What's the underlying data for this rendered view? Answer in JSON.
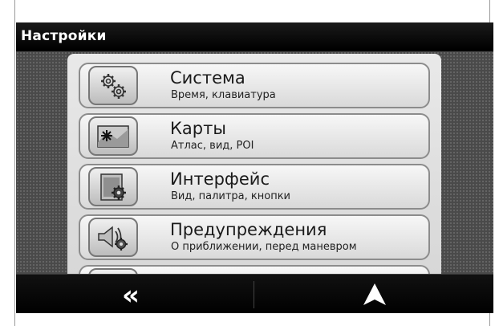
{
  "window": {
    "title": "Настройки"
  },
  "menu": {
    "items": [
      {
        "label": "Система",
        "sublabel": "Время, клавиатура",
        "icon": "gears-icon"
      },
      {
        "label": "Карты",
        "sublabel": "Атлас, вид, POI",
        "icon": "map-icon"
      },
      {
        "label": "Интерфейс",
        "sublabel": "Вид, палитра, кнопки",
        "icon": "interface-settings-icon"
      },
      {
        "label": "Предупреждения",
        "sublabel": "О приближении, перед маневром",
        "icon": "speaker-warning-icon"
      }
    ]
  },
  "footer": {
    "back_glyph": "«",
    "back_icon": "back-double-chevron-icon",
    "navigate_icon": "navigation-arrow-icon"
  }
}
